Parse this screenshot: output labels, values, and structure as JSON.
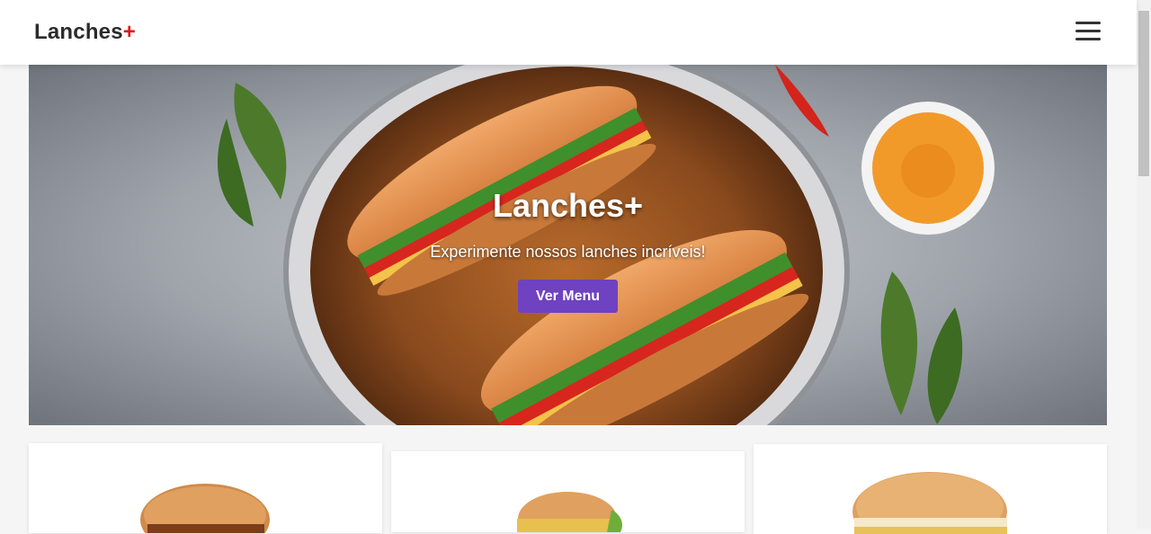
{
  "navbar": {
    "brand_text": "Lanches",
    "brand_plus": "+",
    "menu_icon": "hamburger-menu-icon"
  },
  "hero": {
    "title": "Lanches+",
    "subtitle": "Experimente nossos lanches incríveis!",
    "button_label": "Ver Menu"
  },
  "colors": {
    "accent": "#6f42c1",
    "brand_plus": "#e3141b"
  },
  "cards": [
    {
      "image": "burger-image"
    },
    {
      "image": "burger-image"
    },
    {
      "image": "burger-image"
    }
  ]
}
